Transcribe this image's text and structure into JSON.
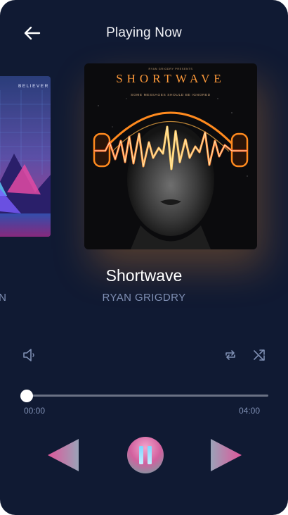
{
  "header": {
    "title": "Playing Now"
  },
  "icons": {
    "back": "arrow-left-icon",
    "volume": "volume-icon",
    "repeat": "repeat-icon",
    "shuffle": "shuffle-icon",
    "previous": "previous-triangle-icon",
    "pause": "pause-icon",
    "next": "next-triangle-icon"
  },
  "left_album": {
    "cover_text": "BELIEVER",
    "title_partial": "",
    "artist_partial": "ON"
  },
  "now_playing": {
    "cover_small_text": "RYAN GRIGDRY PRESENTS",
    "cover_title": "SHORTWAVE",
    "cover_tagline": "SOME MESSAGES SHOULD BE IGNORED",
    "title": "Shortwave",
    "artist": "RYAN GRIGDRY"
  },
  "playback": {
    "current_time": "00:00",
    "total_time": "04:00",
    "progress_fraction": 0.0,
    "state": "playing"
  },
  "colors": {
    "background": "#101a33",
    "accent_pink": "#e0569a",
    "accent_glow": "#ff9828",
    "muted_text": "#7f8fb3",
    "track": "#6a7184"
  }
}
